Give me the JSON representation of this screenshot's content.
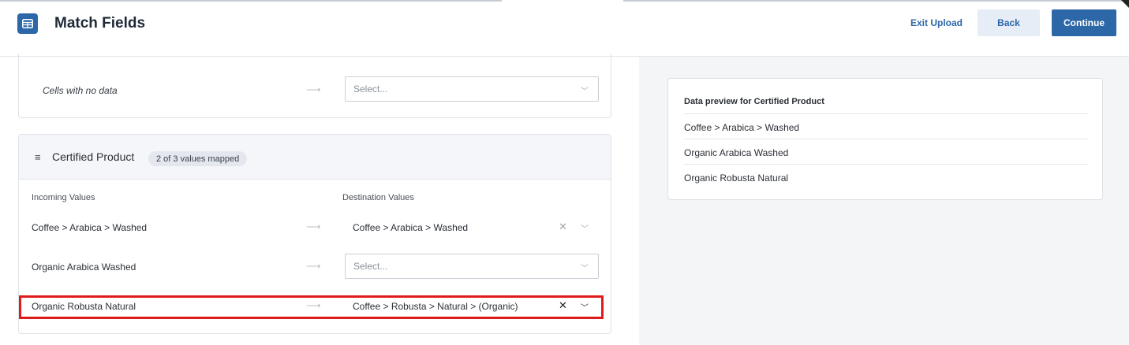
{
  "header": {
    "title": "Match Fields",
    "app_icon": "table-icon",
    "exit_label": "Exit Upload",
    "back_label": "Back",
    "continue_label": "Continue"
  },
  "empty_cells": {
    "label": "Cells with no data",
    "select_placeholder": "Select..."
  },
  "field_section": {
    "title": "Certified Product",
    "badge": "2 of 3 values mapped",
    "incoming_header": "Incoming Values",
    "destination_header": "Destination Values",
    "rows": [
      {
        "incoming": "Coffee > Arabica > Washed",
        "destination": "Coffee > Arabica > Washed",
        "mapped": true
      },
      {
        "incoming": "Organic Arabica Washed",
        "destination": "Select...",
        "mapped": false
      },
      {
        "incoming": "Organic Robusta Natural",
        "destination": "Coffee > Robusta > Natural > (Organic)",
        "mapped": true
      }
    ]
  },
  "preview": {
    "title": "Data preview for Certified Product",
    "items": [
      "Coffee > Arabica > Washed",
      "Organic Arabica Washed",
      "Organic Robusta Natural"
    ]
  },
  "colors": {
    "accent": "#2c67a8",
    "highlight": "#e01b1b",
    "right_panel_bg": "#f4f5f7"
  }
}
